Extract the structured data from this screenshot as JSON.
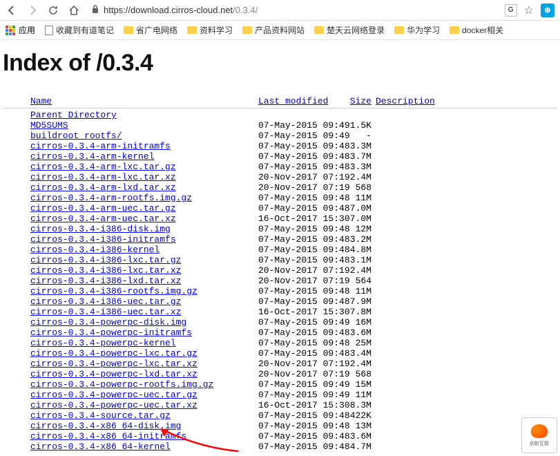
{
  "browser": {
    "url_scheme": "https://",
    "url_domain": "download.cirros-cloud.net",
    "url_path": "/0.3.4/"
  },
  "bookmarks": {
    "apps": "应用",
    "items": [
      {
        "icon": "page",
        "label": "收藏到有道笔记"
      },
      {
        "icon": "folder",
        "label": "省广电网络"
      },
      {
        "icon": "folder",
        "label": "资料学习"
      },
      {
        "icon": "folder",
        "label": "产品资料网站"
      },
      {
        "icon": "folder",
        "label": "楚天云网络登录"
      },
      {
        "icon": "folder",
        "label": "华为学习"
      },
      {
        "icon": "folder",
        "label": "docker相关"
      }
    ]
  },
  "page": {
    "title": "Index of /0.3.4",
    "headers": {
      "name": "Name",
      "modified": "Last modified",
      "size": "Size",
      "description": "Description"
    },
    "files": [
      {
        "name": "Parent Directory",
        "modified": "",
        "size": ""
      },
      {
        "name": "MD5SUMS",
        "modified": "07-May-2015 09:49",
        "size": "1.5K"
      },
      {
        "name": "buildroot_rootfs/",
        "modified": "07-May-2015 09:49",
        "size": "-"
      },
      {
        "name": "cirros-0.3.4-arm-initramfs",
        "modified": "07-May-2015 09:48",
        "size": "3.3M"
      },
      {
        "name": "cirros-0.3.4-arm-kernel",
        "modified": "07-May-2015 09:48",
        "size": "3.7M"
      },
      {
        "name": "cirros-0.3.4-arm-lxc.tar.gz",
        "modified": "07-May-2015 09:48",
        "size": "3.3M"
      },
      {
        "name": "cirros-0.3.4-arm-lxc.tar.xz",
        "modified": "20-Nov-2017 07:19",
        "size": "2.4M"
      },
      {
        "name": "cirros-0.3.4-arm-lxd.tar.xz",
        "modified": "20-Nov-2017 07:19",
        "size": "568"
      },
      {
        "name": "cirros-0.3.4-arm-rootfs.img.gz",
        "modified": "07-May-2015 09:48",
        "size": "11M"
      },
      {
        "name": "cirros-0.3.4-arm-uec.tar.gz",
        "modified": "07-May-2015 09:48",
        "size": "7.0M"
      },
      {
        "name": "cirros-0.3.4-arm-uec.tar.xz",
        "modified": "16-Oct-2017 15:30",
        "size": "7.0M"
      },
      {
        "name": "cirros-0.3.4-i386-disk.img",
        "modified": "07-May-2015 09:48",
        "size": "12M"
      },
      {
        "name": "cirros-0.3.4-i386-initramfs",
        "modified": "07-May-2015 09:48",
        "size": "3.2M"
      },
      {
        "name": "cirros-0.3.4-i386-kernel",
        "modified": "07-May-2015 09:48",
        "size": "4.8M"
      },
      {
        "name": "cirros-0.3.4-i386-lxc.tar.gz",
        "modified": "07-May-2015 09:48",
        "size": "3.1M"
      },
      {
        "name": "cirros-0.3.4-i386-lxc.tar.xz",
        "modified": "20-Nov-2017 07:19",
        "size": "2.4M"
      },
      {
        "name": "cirros-0.3.4-i386-lxd.tar.xz",
        "modified": "20-Nov-2017 07:19",
        "size": "564"
      },
      {
        "name": "cirros-0.3.4-i386-rootfs.img.gz",
        "modified": "07-May-2015 09:48",
        "size": "11M"
      },
      {
        "name": "cirros-0.3.4-i386-uec.tar.gz",
        "modified": "07-May-2015 09:48",
        "size": "7.9M"
      },
      {
        "name": "cirros-0.3.4-i386-uec.tar.xz",
        "modified": "16-Oct-2017 15:30",
        "size": "7.8M"
      },
      {
        "name": "cirros-0.3.4-powerpc-disk.img",
        "modified": "07-May-2015 09:49",
        "size": "16M"
      },
      {
        "name": "cirros-0.3.4-powerpc-initramfs",
        "modified": "07-May-2015 09:48",
        "size": "3.6M"
      },
      {
        "name": "cirros-0.3.4-powerpc-kernel",
        "modified": "07-May-2015 09:48",
        "size": "25M"
      },
      {
        "name": "cirros-0.3.4-powerpc-lxc.tar.gz",
        "modified": "07-May-2015 09:48",
        "size": "3.4M"
      },
      {
        "name": "cirros-0.3.4-powerpc-lxc.tar.xz",
        "modified": "20-Nov-2017 07:19",
        "size": "2.4M"
      },
      {
        "name": "cirros-0.3.4-powerpc-lxd.tar.xz",
        "modified": "20-Nov-2017 07:19",
        "size": "568"
      },
      {
        "name": "cirros-0.3.4-powerpc-rootfs.img.gz",
        "modified": "07-May-2015 09:49",
        "size": "15M"
      },
      {
        "name": "cirros-0.3.4-powerpc-uec.tar.gz",
        "modified": "07-May-2015 09:49",
        "size": "11M"
      },
      {
        "name": "cirros-0.3.4-powerpc-uec.tar.xz",
        "modified": "16-Oct-2017 15:30",
        "size": "8.3M"
      },
      {
        "name": "cirros-0.3.4-source.tar.gz",
        "modified": "07-May-2015 09:48",
        "size": "422K"
      },
      {
        "name": "cirros-0.3.4-x86_64-disk.img",
        "modified": "07-May-2015 09:48",
        "size": "13M"
      },
      {
        "name": "cirros-0.3.4-x86_64-initramfs",
        "modified": "07-May-2015 09:48",
        "size": "3.6M"
      },
      {
        "name": "cirros-0.3.4-x86_64-kernel",
        "modified": "07-May-2015 09:48",
        "size": "4.7M"
      }
    ]
  },
  "watermark": "创新互联"
}
